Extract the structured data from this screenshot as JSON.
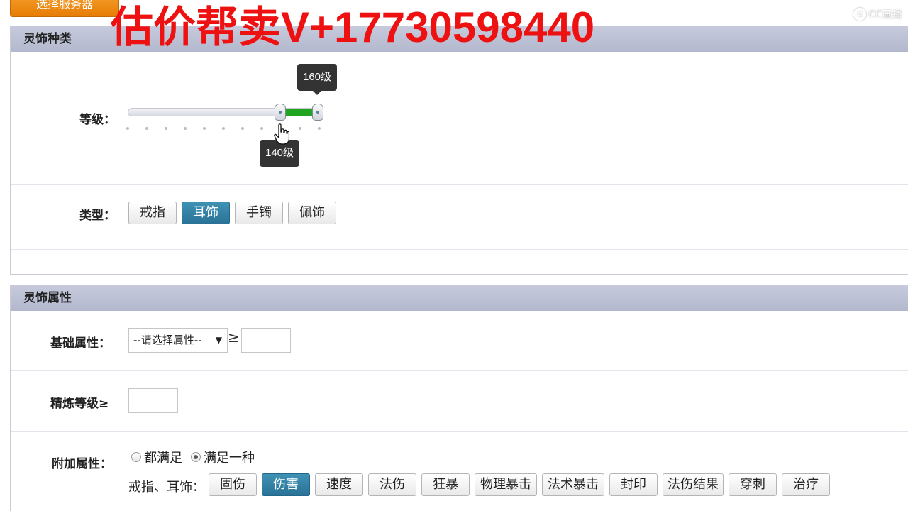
{
  "top_button": {
    "label": "选择服务器"
  },
  "watermark": {
    "text": "估价帮卖V+17730598440"
  },
  "cc_logo": {
    "text": "CC画播"
  },
  "section_type": {
    "header": "灵饰种类",
    "level": {
      "label": "等级：",
      "tooltip_low": "140级",
      "tooltip_high": "160级",
      "range": [
        140,
        160
      ]
    },
    "type": {
      "label": "类型：",
      "options": [
        "戒指",
        "耳饰",
        "手镯",
        "佩饰"
      ],
      "selected": "耳饰"
    }
  },
  "section_attr": {
    "header": "灵饰属性",
    "basic": {
      "label": "基础属性：",
      "select_value": "--请选择属性--",
      "arrow": "▼",
      "ge": "≥",
      "value": ""
    },
    "refine": {
      "label": "精炼等级≥",
      "value": ""
    },
    "extra": {
      "label": "附加属性：",
      "radio_all": "都满足",
      "radio_one": "满足一种",
      "selected_radio": "满足一种",
      "row_label": "戒指、耳饰：",
      "options": [
        "固伤",
        "伤害",
        "速度",
        "法伤",
        "狂暴",
        "物理暴击",
        "法术暴击",
        "封印",
        "法伤结果",
        "穿刺",
        "治疗"
      ],
      "selected": "伤害"
    }
  }
}
